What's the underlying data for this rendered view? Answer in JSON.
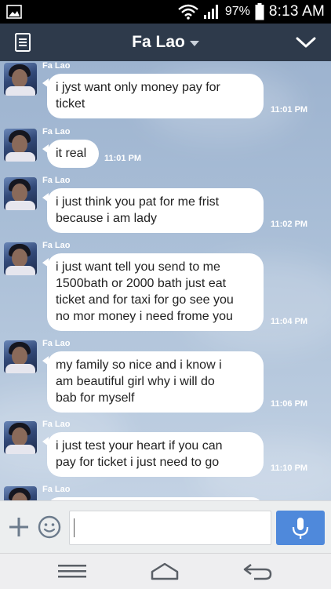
{
  "status_bar": {
    "battery_percent": "97%",
    "time": "8:13 AM"
  },
  "header": {
    "title": "Fa Lao"
  },
  "messages": [
    {
      "sender": "Fa Lao",
      "lines": [
        "i jyst want only money  pay for",
        "ticket"
      ],
      "time": "11:01 PM"
    },
    {
      "sender": "Fa Lao",
      "lines": [
        "it real"
      ],
      "time": "11:01 PM"
    },
    {
      "sender": "Fa Lao",
      "lines": [
        "i just think you pat for me frist",
        "because i am lady"
      ],
      "time": "11:02 PM"
    },
    {
      "sender": "Fa Lao",
      "lines": [
        "i just want tell you send to me",
        "1500bath or 2000 bath just eat",
        "ticket and for taxi for go see you",
        "no mor money i need frome you"
      ],
      "time": "11:04 PM"
    },
    {
      "sender": "Fa Lao",
      "lines": [
        "my family so nice and i know i",
        "am beautiful girl why i will do",
        "bab for myself"
      ],
      "time": "11:06 PM"
    },
    {
      "sender": "Fa Lao",
      "lines": [
        "i just test your heart if you can",
        "pay for ticket i just need to go"
      ],
      "time": "11:10 PM"
    },
    {
      "sender": "Fa Lao",
      "lines": [],
      "time": ""
    }
  ],
  "input": {
    "value": ""
  },
  "colors": {
    "header_bg": "#2e3a4b",
    "send_button": "#4f89db",
    "bubble_bg": "#ffffff"
  },
  "icons": {
    "status_left": "image-icon",
    "wifi": "wifi-icon",
    "signal": "signal-icon",
    "battery": "battery-icon",
    "menu": "notes-icon",
    "collapse": "chevron-down-icon",
    "plus": "plus-icon",
    "emoji": "emoji-icon",
    "mic": "mic-icon",
    "nav_menu": "menu-icon",
    "nav_home": "home-icon",
    "nav_back": "back-icon"
  }
}
